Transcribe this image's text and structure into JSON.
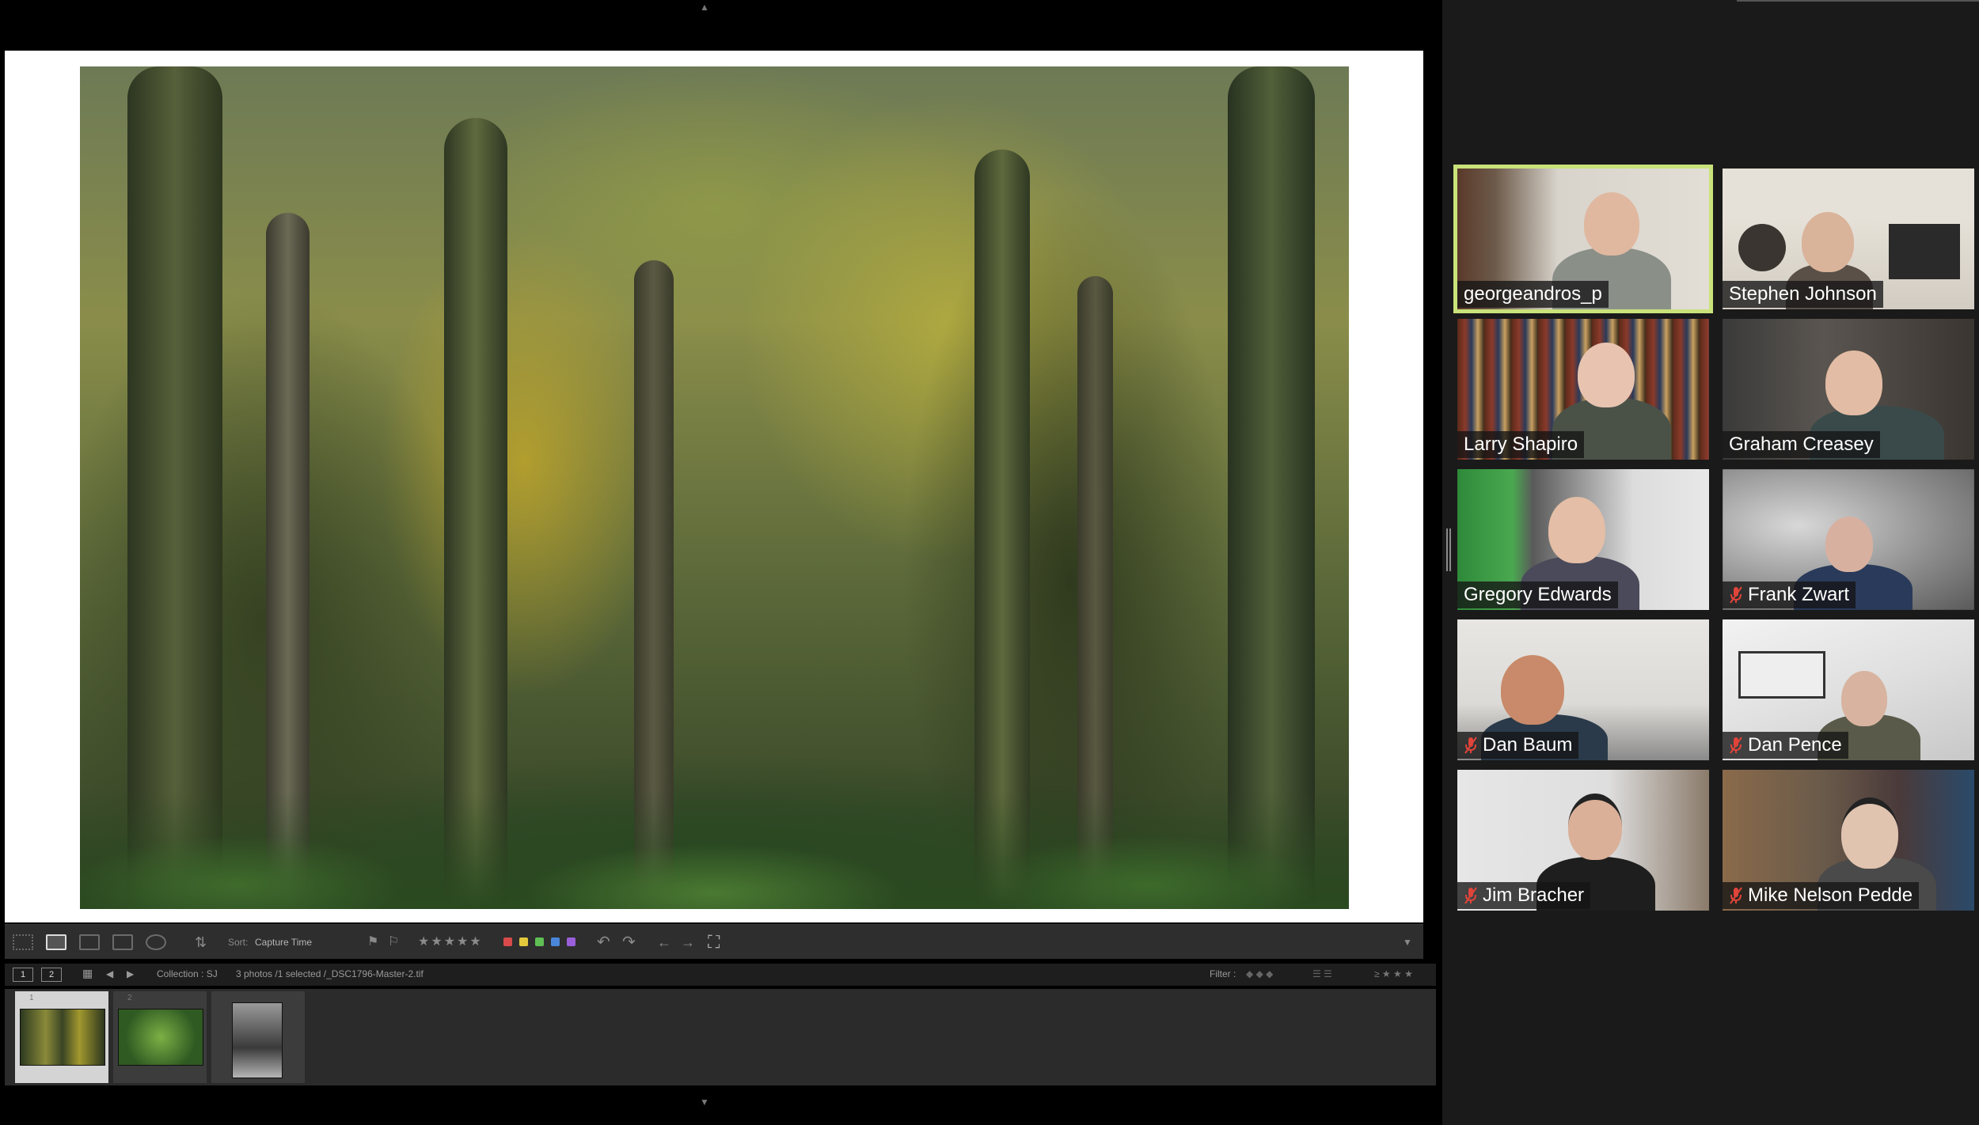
{
  "lightroom": {
    "toolbar": {
      "sort_label": "Sort:",
      "sort_value": "Capture Time",
      "label_colors": [
        "#d94a4a",
        "#e3c83c",
        "#5fbf55",
        "#4a86d9",
        "#9a5fd9"
      ]
    },
    "filmbar": {
      "view_1": "1",
      "view_2": "2",
      "collection": "Collection : SJ",
      "selection_info": "3 photos /1 selected /_DSC1796-Master-2.tif",
      "filter_label": "Filter :"
    },
    "filmstrip": {
      "thumbnails": [
        {
          "number": "1",
          "selected": true
        },
        {
          "number": "2",
          "selected": false
        },
        {
          "number": "",
          "selected": false
        }
      ]
    }
  },
  "gallery": {
    "participants": [
      {
        "name": "georgeandros_p",
        "muted": false,
        "active_speaker": true
      },
      {
        "name": "Stephen Johnson",
        "muted": false,
        "active_speaker": false
      },
      {
        "name": "Larry Shapiro",
        "muted": false,
        "active_speaker": false
      },
      {
        "name": "Graham Creasey",
        "muted": false,
        "active_speaker": false
      },
      {
        "name": "Gregory Edwards",
        "muted": false,
        "active_speaker": false
      },
      {
        "name": "Frank Zwart",
        "muted": true,
        "active_speaker": false
      },
      {
        "name": "Dan Baum",
        "muted": true,
        "active_speaker": false
      },
      {
        "name": "Dan Pence",
        "muted": true,
        "active_speaker": false
      },
      {
        "name": "Jim Bracher",
        "muted": true,
        "active_speaker": false
      },
      {
        "name": "Mike Nelson Pedde",
        "muted": true,
        "active_speaker": false
      }
    ],
    "colors": {
      "active_speaker_border": "#c9e27a",
      "muted_icon": "#e0443a"
    }
  }
}
